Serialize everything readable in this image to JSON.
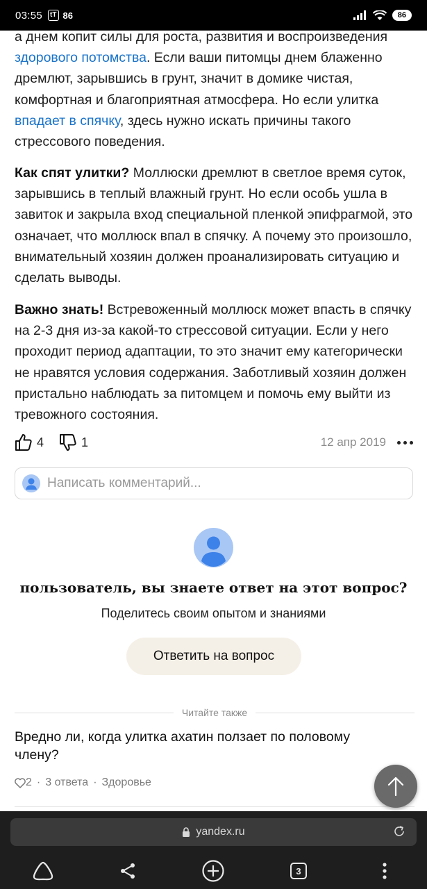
{
  "status_bar": {
    "time": "03:55",
    "notification_count": "86",
    "battery": "86"
  },
  "article": {
    "p1": {
      "t1": "а днем копит силы для роста, развития и воспроизведения ",
      "link1": "здорового потомства",
      "t2": ". Если ваши питомцы днем блаженно дремлют, зарывшись в грунт, значит в домике чистая, комфортная и благоприятная атмосфера. Но если улитка ",
      "link2": "впадает в спячку",
      "t3": ", здесь нужно искать причины такого стрессового поведения."
    },
    "p2": {
      "bold": "Как спят улитки?",
      "text": " Моллюски дремлют в светлое время суток, зарывшись в теплый влажный грунт. Но если особь ушла в завиток и закрыла вход специальной пленкой эпифрагмой, это означает, что моллюск впал в спячку. А почему это произошло, внимательный хозяин должен проанализировать ситуацию и сделать выводы."
    },
    "p3": {
      "bold": "Важно знать!",
      "text": " Встревоженный моллюск может впасть в спячку на 2-3 дня из-за какой-то стрессовой ситуации. Если у него проходит период адаптации, то это значит ему категорически не нравятся условия содержания. Заботливый хозяин должен пристально наблюдать за питомцем и помочь ему выйти из тревожного состояния."
    }
  },
  "actions": {
    "likes": "4",
    "dislikes": "1",
    "date": "12 апр 2019"
  },
  "comment": {
    "placeholder": "Написать комментарий..."
  },
  "prompt": {
    "title": "пользователь, вы знаете ответ на этот вопрос?",
    "subtitle": "Поделитесь своим опытом и знаниями",
    "button": "Ответить на вопрос"
  },
  "related": {
    "section_label": "Читайте также",
    "title": "Вредно ли, когда улитка ахатин ползает по половому члену?",
    "likes": "2",
    "answers": "3 ответа",
    "category": "Здоровье"
  },
  "browser": {
    "url": "yandex.ru",
    "tab_count": "3"
  },
  "icons": {
    "like": "thumbs-up-icon",
    "dislike": "thumbs-down-icon",
    "more": "more-dots-icon",
    "avatar": "user-avatar-icon",
    "heart": "heart-icon",
    "scroll_top": "arrow-up-icon",
    "lock": "lock-icon",
    "reload": "reload-icon",
    "home": "alice-home-icon",
    "share": "share-icon",
    "new_tab": "plus-circle-icon",
    "tabs": "tabs-icon",
    "menu": "vertical-dots-icon"
  },
  "colors": {
    "link": "#1a73c9",
    "avatar_blue": "#3d82e8",
    "answer_button_bg": "#f5f0e7",
    "browser_bg": "#1e1e1e"
  }
}
